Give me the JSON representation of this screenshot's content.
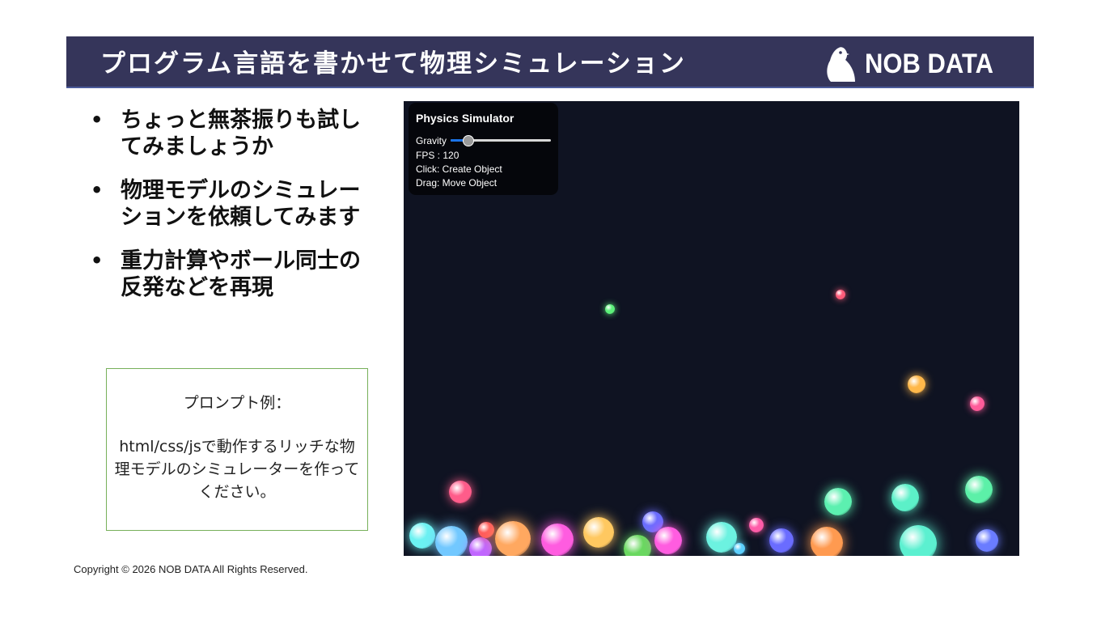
{
  "header": {
    "title": "プログラム言語を書かせて物理シミュレーション",
    "logo_text": "NOB DATA"
  },
  "bullets": [
    {
      "text": "ちょっと無茶振りも試してみましょうか"
    },
    {
      "text": "物理モデルのシミュレーションを依頼してみます"
    },
    {
      "text": "重力計算やボール同士の反発などを再現"
    }
  ],
  "prompt_box": {
    "heading": "プロンプト例：",
    "body": "html/css/jsで動作するリッチな物理モデルのシミュレーターを作ってください。"
  },
  "copyright": "Copyright © 2026 NOB DATA All Rights Reserved.",
  "simulator": {
    "panel": {
      "title": "Physics Simulator",
      "gravity_label": "Gravity",
      "gravity_level": 0.18,
      "fps_text": "FPS : 120",
      "click_hint": "Click: Create Object",
      "drag_hint": "Drag: Move Object"
    },
    "background_color": "#0f1322",
    "slider_accent_color": "#1a73e8"
  },
  "balls": [
    {
      "color": "#5cf07a"
    },
    {
      "color": "#ff5c7a"
    },
    {
      "color": "#ffb84a"
    },
    {
      "color": "#ff5c9a"
    },
    {
      "color": "#ff5c8a"
    },
    {
      "color": "#5cf0b0"
    },
    {
      "color": "#5cf0c8"
    },
    {
      "color": "#5cf0a8"
    },
    {
      "color": "#6cf2f2"
    },
    {
      "color": "#72c8ff"
    },
    {
      "color": "#c066ff"
    },
    {
      "color": "#ff5c5c"
    },
    {
      "color": "#ffa860"
    },
    {
      "color": "#ff5ce0"
    },
    {
      "color": "#ffc860"
    },
    {
      "color": "#6a6cff"
    },
    {
      "color": "#6ad860"
    },
    {
      "color": "#ff5ce0"
    },
    {
      "color": "#6cf2e0"
    },
    {
      "color": "#5cd0ff"
    },
    {
      "color": "#ff5ca8"
    },
    {
      "color": "#6a6cff"
    },
    {
      "color": "#ff9a50"
    },
    {
      "color": "#5cf0d0"
    },
    {
      "color": "#6a7cff"
    }
  ]
}
